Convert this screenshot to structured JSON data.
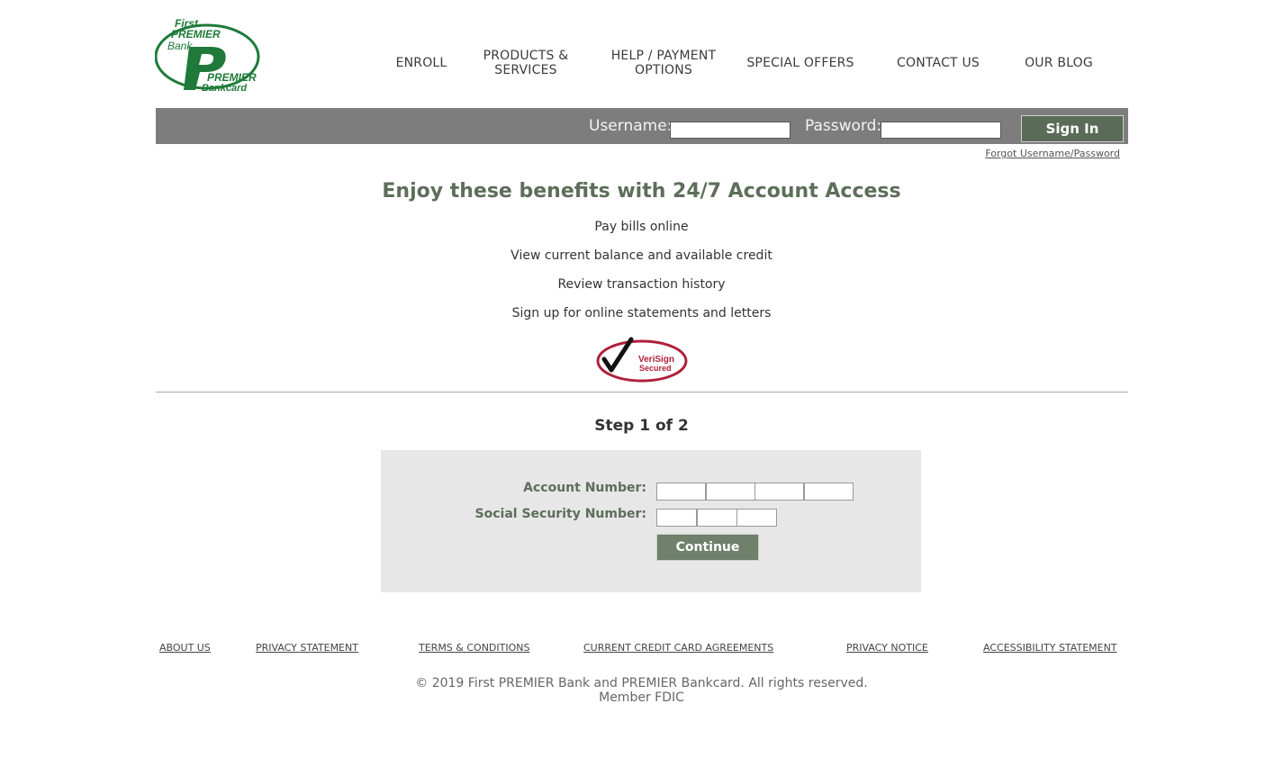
{
  "logo": {
    "line1": "First",
    "line2": "PREMIER",
    "line3": "Bank",
    "line4": "PREMIER",
    "line5": "Bankcard",
    "brand_color": "#1f7a3a"
  },
  "nav": {
    "enroll": "ENROLL",
    "products_line1": "PRODUCTS &",
    "products_line2": "SERVICES",
    "help_line1": "HELP / PAYMENT",
    "help_line2": "OPTIONS",
    "special_offers": "SPECIAL OFFERS",
    "contact_us": "CONTACT US",
    "our_blog": "OUR BLOG"
  },
  "login": {
    "username_label": "Username:",
    "password_label": "Password:",
    "username_value": "",
    "password_value": "",
    "signin_label": "Sign In",
    "forgot_link": "Forgot Username/Password"
  },
  "benefits": {
    "headline": "Enjoy these benefits with 24/7 Account Access",
    "items": [
      "Pay bills online",
      "View current balance and available credit",
      "Review transaction history",
      "Sign up for online statements and letters"
    ]
  },
  "verisign": {
    "line1": "VeriSign",
    "line2": "Secured",
    "icon": "checkmark-icon"
  },
  "form": {
    "step": "Step 1 of 2",
    "account_label": "Account Number:",
    "ssn_label": "Social Security Number:",
    "continue_label": "Continue"
  },
  "footer": {
    "links": [
      "ABOUT US",
      "PRIVACY STATEMENT",
      "TERMS & CONDITIONS",
      "CURRENT CREDIT CARD AGREEMENTS",
      "PRIVACY NOTICE",
      "ACCESSIBILITY STATEMENT"
    ],
    "copyright_line1": "© 2019 First PREMIER Bank and PREMIER Bankcard. All rights reserved.",
    "copyright_line2": "Member FDIC"
  },
  "colors": {
    "accent_green": "#5d6e5a",
    "login_bar": "#7d7d7d",
    "signin_button": "#5a6b57",
    "verisign_red": "#b0203a"
  }
}
